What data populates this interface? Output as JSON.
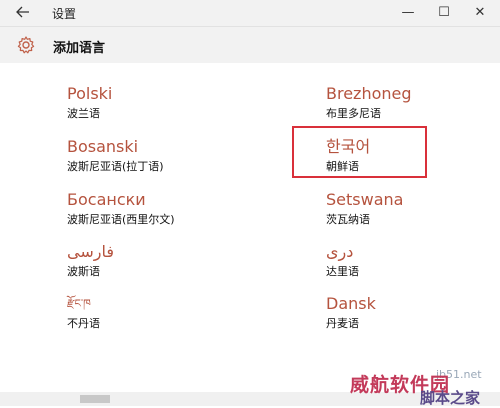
{
  "window": {
    "title": "设置",
    "minimize": "—",
    "maximize": "☐",
    "close": "✕"
  },
  "header": {
    "title": "添加语言"
  },
  "languages": [
    {
      "native": "Polski",
      "chinese": "波兰语"
    },
    {
      "native": "Brezhoneg",
      "chinese": "布里多尼语"
    },
    {
      "native": "Bosanski",
      "chinese": "波斯尼亚语(拉丁语)"
    },
    {
      "native": "한국어",
      "chinese": "朝鲜语"
    },
    {
      "native": "Босански",
      "chinese": "波斯尼亚语(西里尔文)"
    },
    {
      "native": "Setswana",
      "chinese": "茨瓦纳语"
    },
    {
      "native": "فارسى",
      "chinese": "波斯语"
    },
    {
      "native": "درى",
      "chinese": "达里语"
    },
    {
      "native": "རྫོང་ཁ",
      "chinese": "不丹语"
    },
    {
      "native": "Dansk",
      "chinese": "丹麦语"
    }
  ],
  "watermark": {
    "site": "jb51.net",
    "line1": "威航软件园",
    "line2": "脚本之家"
  },
  "colors": {
    "accent": "#b5533e",
    "highlight": "#d9303a"
  },
  "icons": {
    "back": "arrow-left-icon",
    "settings": "gear-icon"
  }
}
